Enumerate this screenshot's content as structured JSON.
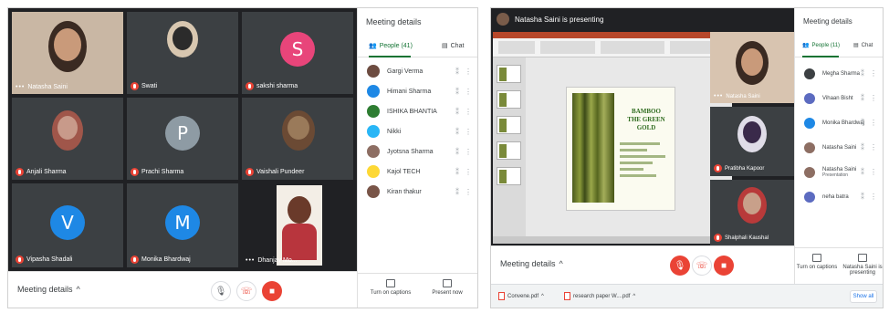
{
  "left": {
    "tiles": [
      {
        "name": "Natasha Saini",
        "kind": "photo",
        "more": "•••"
      },
      {
        "name": "Swati",
        "kind": "photo"
      },
      {
        "name": "sakshi sharma",
        "kind": "letter",
        "letter": "S",
        "color": "#e8457a"
      },
      {
        "name": "Anjali Sharma",
        "kind": "photo"
      },
      {
        "name": "Prachi Sharma",
        "kind": "letter",
        "letter": "P",
        "color": "#8e9ba4"
      },
      {
        "name": "Vaishali Pundeer",
        "kind": "photo"
      },
      {
        "name": "Vipasha Shadali",
        "kind": "letter",
        "letter": "V",
        "color": "#1e88e5"
      },
      {
        "name": "Monika Bhardwaj",
        "kind": "letter",
        "letter": "M",
        "color": "#1e88e5"
      },
      {
        "name": "Dhanjay Mo...",
        "kind": "self",
        "more": "•••"
      }
    ],
    "bottom": {
      "meeting_details": "Meeting details",
      "chevron": "^"
    },
    "panel": {
      "title": "Meeting details",
      "people_tab": "People (41)",
      "chat_tab": "Chat",
      "people": [
        {
          "name": "Gargi Verma",
          "color": "#6d4c41"
        },
        {
          "name": "Himani Sharma",
          "color": "#1e88e5"
        },
        {
          "name": "ISHIKA BHANTIA",
          "color": "#2e7d32"
        },
        {
          "name": "Nikki",
          "color": "#29b6f6"
        },
        {
          "name": "Jyotsna Sharma",
          "color": "#8d6e63"
        },
        {
          "name": "Kajol TECH",
          "color": "#fdd835"
        },
        {
          "name": "Kiran thakur",
          "color": "#795548"
        }
      ],
      "footer": {
        "captions": "Turn on captions",
        "present": "Present now"
      }
    }
  },
  "right": {
    "presenting_label": "Natasha Saini is presenting",
    "slide": {
      "title_line1": "BAMBOO",
      "title_line2": "THE GREEN GOLD"
    },
    "tiles": [
      {
        "name": "Natasha Saini",
        "more": "•••"
      },
      {
        "name": "Pratibha Kapoor"
      },
      {
        "name": "Shalphali Kaushal"
      }
    ],
    "bottom": {
      "meeting_details": "Meeting details",
      "chevron": "^"
    },
    "panel": {
      "title": "Meeting details",
      "people_tab": "People (11)",
      "chat_tab": "Chat",
      "people": [
        {
          "name": "Megha Sharma",
          "color": "#3c4043"
        },
        {
          "name": "Vihaan Bisht",
          "color": "#5c6bc0"
        },
        {
          "name": "Monika Bhardwaj",
          "color": "#1e88e5"
        },
        {
          "name": "Natasha Saini",
          "color": "#8d6e63"
        },
        {
          "name": "Natasha Saini",
          "sub": "Presentation",
          "color": "#8d6e63"
        },
        {
          "name": "neha batra",
          "color": "#5c6bc0"
        }
      ],
      "footer": {
        "captions": "Turn on captions",
        "presenting": "Natasha Saini is presenting"
      }
    },
    "downloads": [
      {
        "file": "Convene.pdf"
      },
      {
        "file": "research paper W....pdf"
      }
    ],
    "show_all": "Show all"
  }
}
